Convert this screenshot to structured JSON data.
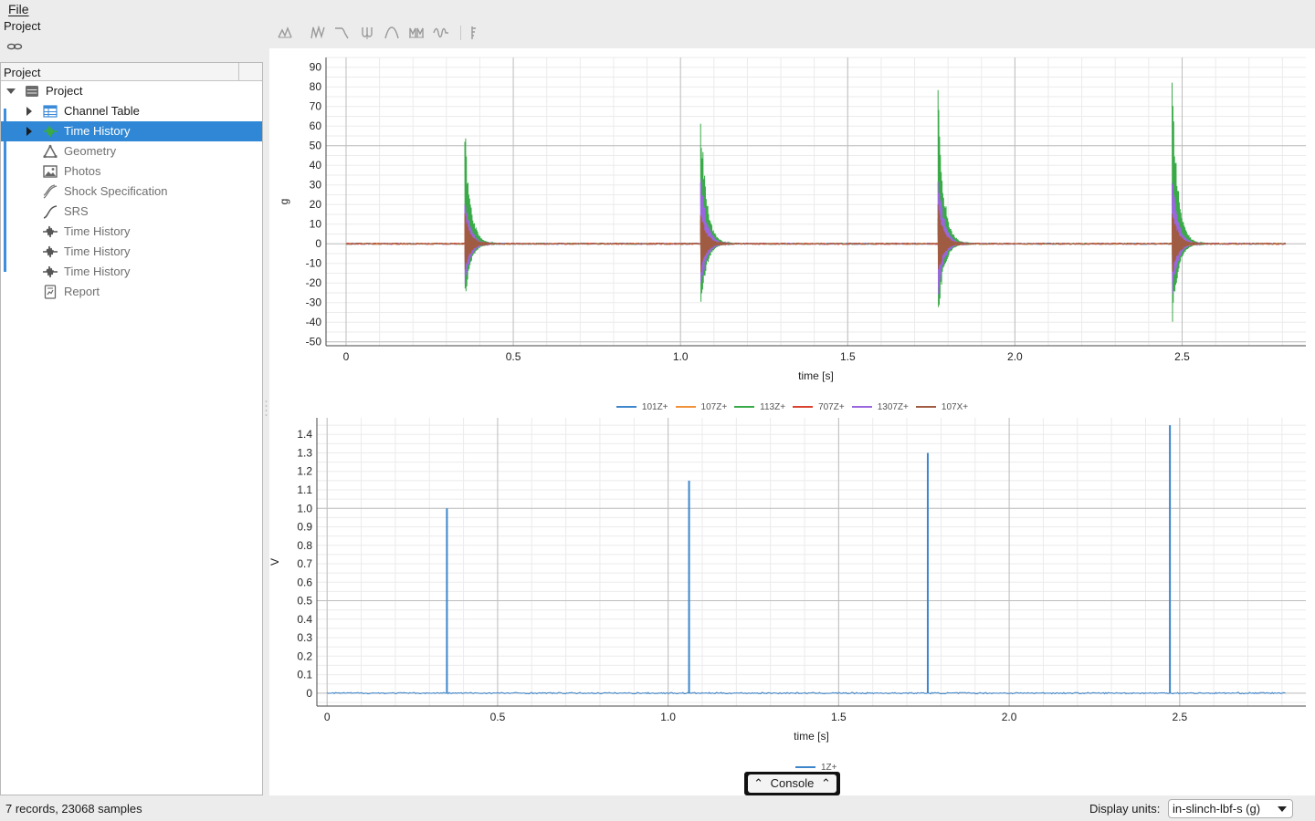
{
  "menu": {
    "file": "File"
  },
  "left_pane": {
    "title": "Project",
    "tree_header": "Project",
    "root": {
      "label": "Project",
      "icon": "database-icon"
    },
    "children": [
      {
        "label": "Channel Table",
        "icon": "table-icon",
        "expandable": true,
        "selected": false
      },
      {
        "label": "Time History",
        "icon": "waveform-icon",
        "expandable": true,
        "selected": true
      },
      {
        "label": "Geometry",
        "icon": "triangle-icon",
        "expandable": false,
        "selected": false
      },
      {
        "label": "Photos",
        "icon": "image-icon",
        "expandable": false,
        "selected": false
      },
      {
        "label": "Shock Specification",
        "icon": "shock-spec-icon",
        "expandable": false,
        "selected": false
      },
      {
        "label": "SRS",
        "icon": "srs-curve-icon",
        "expandable": false,
        "selected": false
      },
      {
        "label": "Time History",
        "icon": "waveform-icon",
        "expandable": false,
        "selected": false
      },
      {
        "label": "Time History",
        "icon": "waveform-icon",
        "expandable": false,
        "selected": false
      },
      {
        "label": "Time History",
        "icon": "waveform-icon",
        "expandable": false,
        "selected": false
      },
      {
        "label": "Report",
        "icon": "report-icon",
        "expandable": false,
        "selected": false
      }
    ]
  },
  "toolbar": {
    "icons": [
      "tool-icon-1",
      "tool-icon-2",
      "tool-icon-3",
      "tool-icon-4",
      "tool-icon-5",
      "tool-icon-6",
      "tool-icon-7",
      "tool-icon-8"
    ]
  },
  "console": {
    "label": "Console"
  },
  "status": {
    "summary": "7 records, 23068 samples",
    "units_label": "Display units:",
    "units_value": "in-slinch-lbf-s (g)"
  },
  "chart_data": [
    {
      "type": "line",
      "xlabel": "time [s]",
      "ylabel": "g",
      "xlim": [
        -0.06,
        2.87
      ],
      "ylim": [
        -52,
        95
      ],
      "xticks": [
        0,
        0.5,
        1.0,
        1.5,
        2.0,
        2.5
      ],
      "xtick_labels": [
        "0",
        "0.5",
        "1.0",
        "1.5",
        "2.0",
        "2.5"
      ],
      "yticks": [
        -50,
        -40,
        -30,
        -20,
        -10,
        0,
        10,
        20,
        30,
        40,
        50,
        60,
        70,
        80,
        90
      ],
      "grid": true,
      "legend": "bottom",
      "x_range": [
        0,
        2.81
      ],
      "shock_times": [
        0.355,
        1.06,
        1.77,
        2.47
      ],
      "series": [
        {
          "name": "101Z+",
          "color": "#3d86cc",
          "peaks": [
            [
              8,
              -6
            ],
            [
              10,
              -8
            ],
            [
              11,
              -9
            ],
            [
              12,
              -10
            ]
          ]
        },
        {
          "name": "107Z+",
          "color": "#f0923a",
          "peaks": [
            [
              6,
              -5
            ],
            [
              8,
              -6
            ],
            [
              9,
              -7
            ],
            [
              10,
              -8
            ]
          ]
        },
        {
          "name": "113Z+",
          "color": "#3aaa48",
          "peaks": [
            [
              62,
              -32
            ],
            [
              72,
              -37
            ],
            [
              80,
              -41
            ],
            [
              88,
              -46
            ]
          ]
        },
        {
          "name": "707Z+",
          "color": "#d9432f",
          "peaks": [
            [
              12,
              -10
            ],
            [
              13,
              -11
            ],
            [
              14,
              -12
            ],
            [
              15,
              -13
            ]
          ]
        },
        {
          "name": "1307Z+",
          "color": "#9a66de",
          "peaks": [
            [
              26,
              -23
            ],
            [
              39,
              -26
            ],
            [
              40,
              -28
            ],
            [
              39,
              -29
            ]
          ]
        },
        {
          "name": "107X+",
          "color": "#a05c42",
          "peaks": [
            [
              17,
              -15
            ],
            [
              18,
              -16
            ],
            [
              22,
              -17
            ],
            [
              20,
              -18
            ]
          ]
        }
      ]
    },
    {
      "type": "line",
      "xlabel": "time [s]",
      "ylabel": "V",
      "xlim": [
        -0.03,
        2.87
      ],
      "ylim": [
        -0.07,
        1.49
      ],
      "xticks": [
        0,
        0.5,
        1.0,
        1.5,
        2.0,
        2.5
      ],
      "xtick_labels": [
        "0",
        "0.5",
        "1.0",
        "1.5",
        "2.0",
        "2.5"
      ],
      "yticks": [
        0,
        0.1,
        0.2,
        0.3,
        0.4,
        0.5,
        0.6,
        0.7,
        0.8,
        0.9,
        1.0,
        1.1,
        1.2,
        1.3,
        1.4
      ],
      "ytick_labels": [
        "0",
        "0.1",
        "0.2",
        "0.3",
        "0.4",
        "0.5",
        "0.6",
        "0.7",
        "0.8",
        "0.9",
        "1.0",
        "1.1",
        "1.2",
        "1.3",
        "1.4"
      ],
      "grid": true,
      "legend": "bottom",
      "x_range": [
        0,
        2.81
      ],
      "series": [
        {
          "name": "1Z+",
          "color": "#3d86cc",
          "pulses": [
            [
              0.35,
              1.0
            ],
            [
              1.06,
              1.15
            ],
            [
              1.76,
              1.3
            ],
            [
              2.47,
              1.45
            ]
          ]
        }
      ]
    }
  ]
}
